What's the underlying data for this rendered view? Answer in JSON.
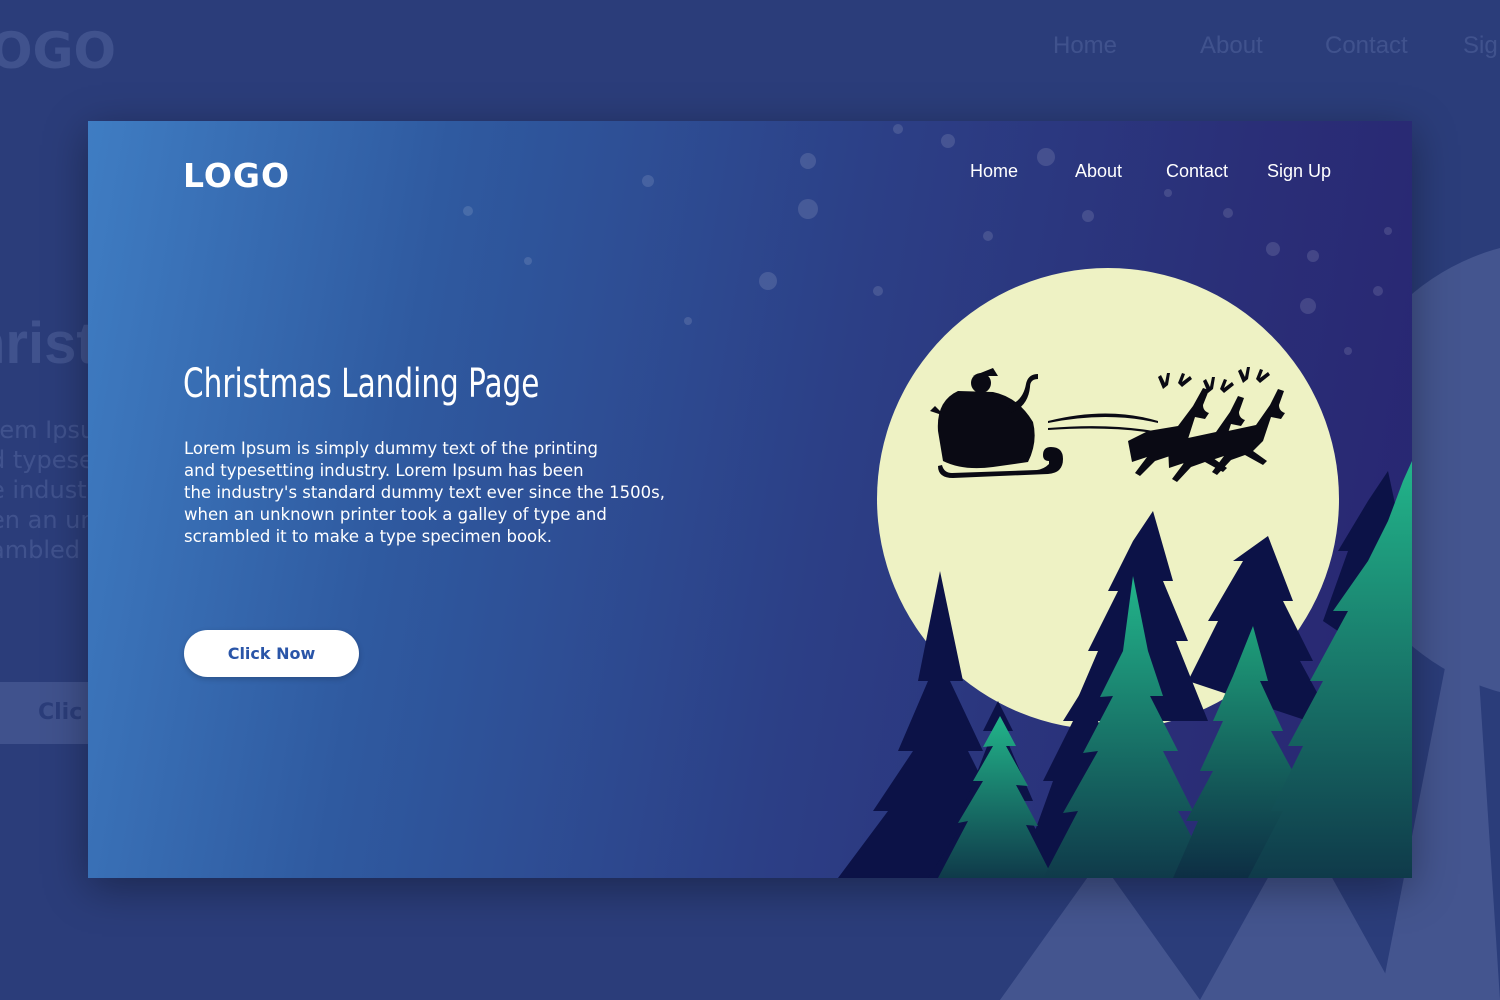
{
  "header": {
    "logo": "LOGO",
    "nav": [
      {
        "label": "Home"
      },
      {
        "label": "About"
      },
      {
        "label": "Contact"
      },
      {
        "label": "Sign Up"
      }
    ]
  },
  "hero": {
    "title": "Christmas Landing Page",
    "description_lines": [
      "Lorem Ipsum is simply dummy text of the printing",
      "and typesetting industry. Lorem Ipsum has been",
      "the industry's standard dummy text ever since the 1500s,",
      "when an unknown printer took a galley of type and",
      "scrambled it to make a type specimen book."
    ],
    "cta_label": "Click Now"
  },
  "background_ghost": {
    "logo": "OGO",
    "nav": [
      "Home",
      "About",
      "Contact",
      "Sig"
    ],
    "title": "hrist",
    "text_lines": [
      "rem Ipsu",
      "d typeset",
      "e industry",
      "en an un",
      "ambled i"
    ],
    "button": "Clic"
  },
  "colors": {
    "moon": "#eef2c4",
    "tree_dark": "#0c1247",
    "tree_green": "#1f9a76",
    "cta_text": "#2a55a8"
  },
  "icons": {
    "moon": "moon-icon",
    "sleigh": "santa-sleigh-icon",
    "reindeer": "reindeer-icon"
  }
}
